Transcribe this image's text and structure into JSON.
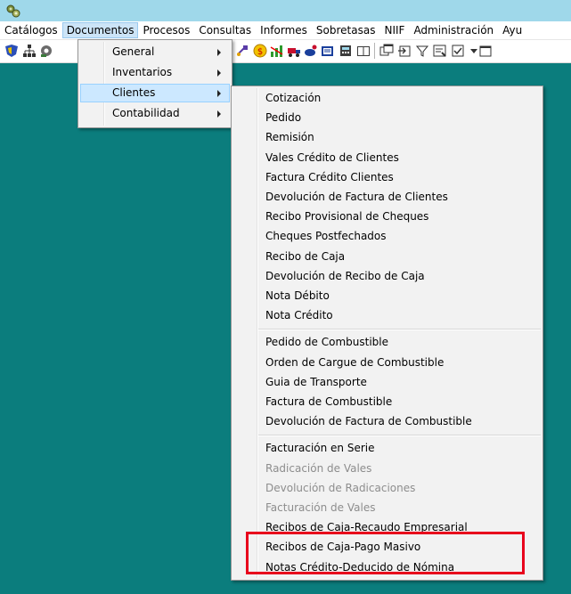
{
  "menubar": {
    "items": [
      "Catálogos",
      "Documentos",
      "Procesos",
      "Consultas",
      "Informes",
      "Sobretasas",
      "NIIF",
      "Administración",
      "Ayu"
    ]
  },
  "documentos_menu": {
    "items": [
      "General",
      "Inventarios",
      "Clientes",
      "Contabilidad"
    ],
    "active": "Clientes"
  },
  "clientes_menu": {
    "groups": [
      [
        "Cotización",
        "Pedido",
        "Remisión",
        "Vales Crédito de Clientes",
        "Factura Crédito Clientes",
        "Devolución de Factura de Clientes",
        "Recibo Provisional de Cheques",
        "Cheques Postfechados",
        "Recibo de Caja",
        "Devolución de Recibo de Caja",
        "Nota Débito",
        "Nota Crédito"
      ],
      [
        "Pedido de Combustible",
        "Orden de Cargue de Combustible",
        "Guia de Transporte",
        "Factura de Combustible",
        "Devolución de Factura de Combustible"
      ],
      [
        "Facturación en Serie",
        "Radicación de Vales",
        "Devolución de Radicaciones",
        "Facturación de Vales",
        "Recibos de Caja-Recaudo Empresarial",
        "Recibos de Caja-Pago Masivo",
        "Notas Crédito-Deducido de Nómina"
      ]
    ],
    "disabled": [
      "Radicación de Vales",
      "Devolución de Radicaciones",
      "Facturación de Vales"
    ],
    "highlighted": [
      "Recibos de Caja-Pago Masivo",
      "Notas Crédito-Deducido de Nómina"
    ]
  },
  "colors": {
    "workspace": "#0b7d7d",
    "titlebar": "#9fd8ea",
    "menu_background": "#f2f2f2",
    "highlight_box": "#e8001c"
  },
  "toolbar_icons": [
    "shield-icon",
    "network-icon",
    "gear-icon",
    "satellite-icon",
    "warning-icon",
    "chart-icon",
    "truck-icon",
    "dish-icon",
    "folder-icon",
    "calculator-icon",
    "book-icon",
    "window-icon",
    "import-icon",
    "filter-icon",
    "form-icon",
    "checklist-icon",
    "dropdown-icon",
    "window-icon"
  ]
}
